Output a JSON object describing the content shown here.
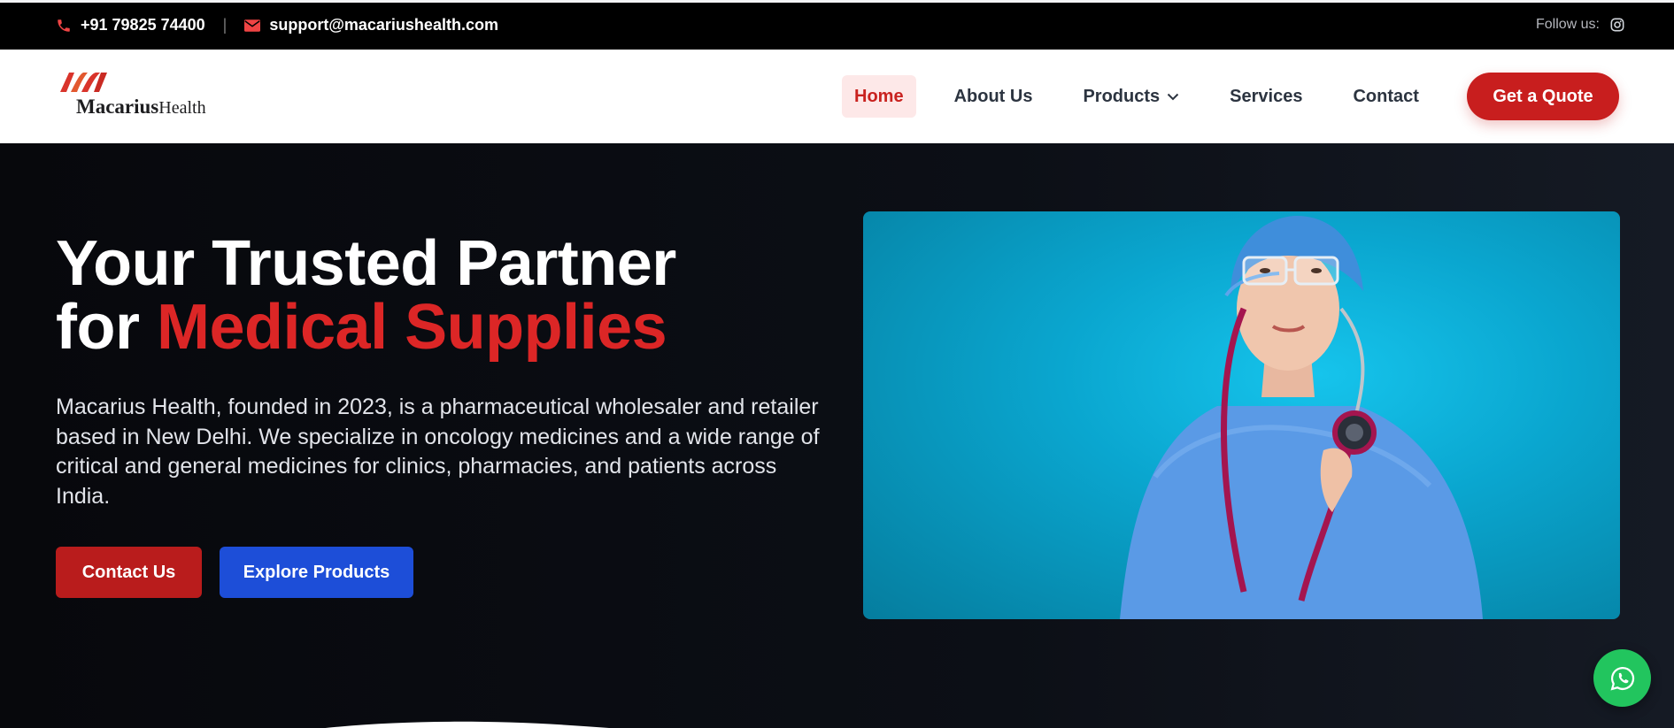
{
  "topbar": {
    "phone": "+91 79825 74400",
    "separator": "|",
    "email": "support@macariushealth.com",
    "follow_label": "Follow us:",
    "icons": [
      "phone-icon",
      "mail-icon",
      "instagram-icon"
    ]
  },
  "brand": {
    "name_bold": "Macarius",
    "name_light": "Health"
  },
  "nav": {
    "items": [
      {
        "label": "Home",
        "active": true
      },
      {
        "label": "About Us"
      },
      {
        "label": "Products",
        "dropdown": true
      },
      {
        "label": "Services"
      },
      {
        "label": "Contact"
      }
    ],
    "cta": "Get a Quote"
  },
  "hero": {
    "title_line1": "Your Trusted Partner",
    "title_line2_prefix": "for",
    "title_line2_accent": "Medical Supplies",
    "description": "Macarius Health, founded in 2023, is a pharmaceutical wholesaler and retailer based in New Delhi. We specialize in oncology medicines and a wide range of critical and general medicines for clinics, pharmacies, and patients across India.",
    "primary_button": "Contact Us",
    "secondary_button": "Explore Products"
  },
  "colors": {
    "accent_red": "#dc2626",
    "button_red": "#b91c1c",
    "button_blue": "#1d4ed8",
    "whatsapp_green": "#22c55e",
    "hero_bg": "#0b0d12"
  }
}
